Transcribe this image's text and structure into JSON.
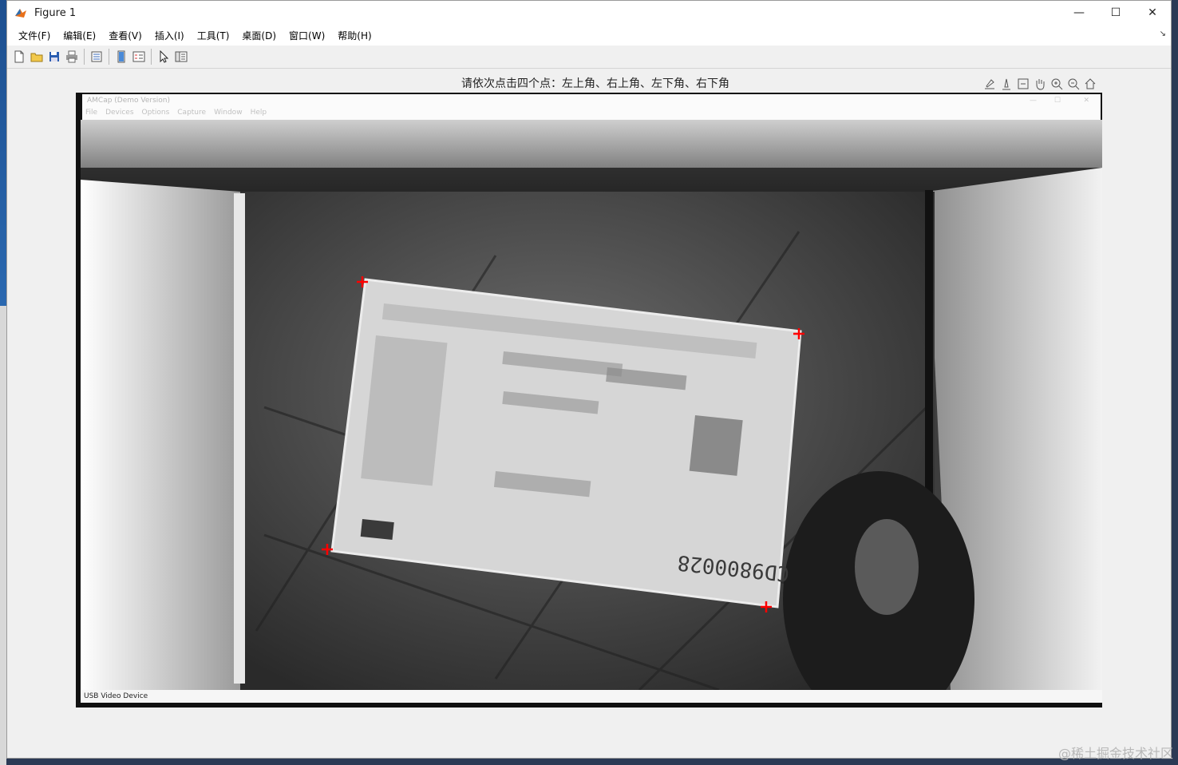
{
  "window": {
    "title": "Figure 1",
    "controls": [
      "—",
      "☐",
      "✕"
    ]
  },
  "menu": [
    "文件(F)",
    "编辑(E)",
    "查看(V)",
    "插入(I)",
    "工具(T)",
    "桌面(D)",
    "窗口(W)",
    "帮助(H)"
  ],
  "dock_glyph": "↘",
  "axes": {
    "title": "请依次点击四个点：左上角、右上角、左下角、右下角"
  },
  "amcap": {
    "title": "AMCap (Demo Version)",
    "menu": [
      "File",
      "Devices",
      "Options",
      "Capture",
      "Window",
      "Help"
    ],
    "status": "USB Video Device"
  },
  "card": {
    "number": "CD9800028"
  },
  "markers": {
    "color": "#ff0000",
    "count": 4
  },
  "watermark": "@稀土掘金技术社区"
}
